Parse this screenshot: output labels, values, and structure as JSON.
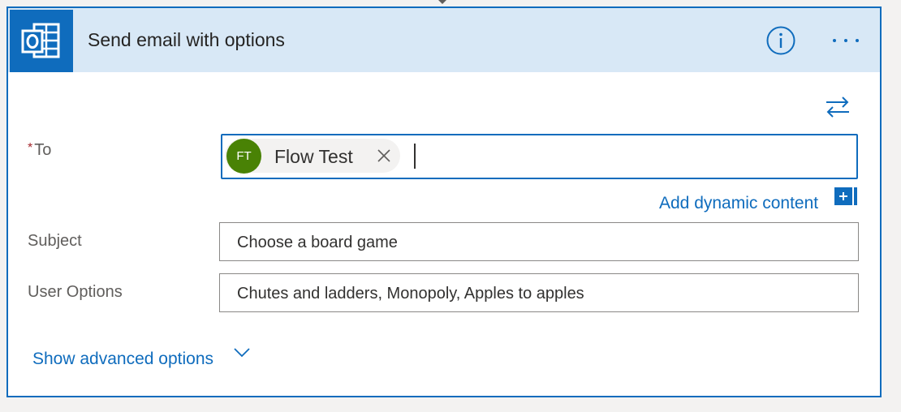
{
  "card": {
    "title": "Send email with options",
    "app_icon": "outlook-icon",
    "info_icon": "info-icon",
    "more_icon": "ellipsis-icon",
    "swap_icon": "swap-arrows-icon"
  },
  "fields": {
    "to": {
      "label": "To",
      "required_mark": "*",
      "recipient": {
        "initials": "FT",
        "name": "Flow Test",
        "avatar_color": "#498205"
      }
    },
    "dynamic_content_label": "Add dynamic content",
    "subject": {
      "label": "Subject",
      "value": "Choose a board game"
    },
    "user_options": {
      "label": "User Options",
      "value": "Chutes and ladders, Monopoly, Apples to apples"
    }
  },
  "advanced": {
    "label": "Show advanced options",
    "icon": "chevron-down-icon"
  },
  "colors": {
    "accent": "#0f6cbd",
    "header_bg": "#d8e8f6",
    "required": "#a4262c"
  }
}
